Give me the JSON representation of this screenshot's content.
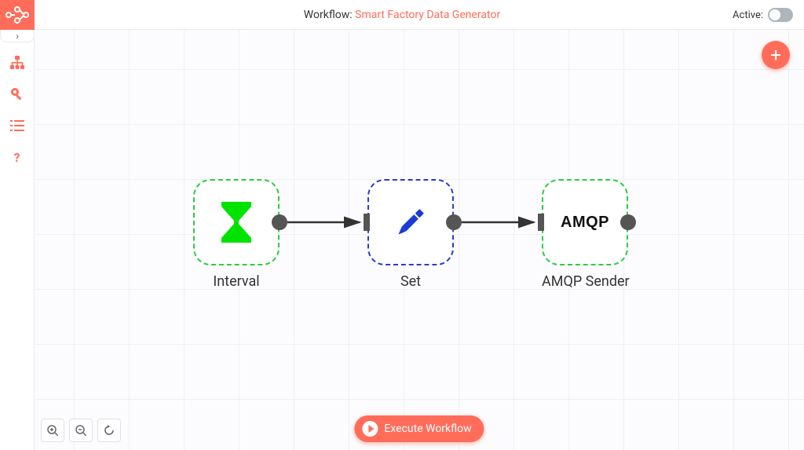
{
  "header": {
    "prefix": "Workflow: ",
    "name": "Smart Factory Data Generator",
    "active_label": "Active:",
    "active": false
  },
  "sidebar": {
    "items": [
      {
        "name": "workflows",
        "icon": "sitemap-icon"
      },
      {
        "name": "credentials",
        "icon": "key-icon"
      },
      {
        "name": "executions",
        "icon": "list-icon"
      },
      {
        "name": "help",
        "icon": "question-icon"
      }
    ]
  },
  "canvas": {
    "add_label": "+",
    "nodes": [
      {
        "id": "interval",
        "label": "Interval",
        "type": "trigger",
        "border": "green",
        "icon": "hourglass",
        "icon_text": ""
      },
      {
        "id": "set",
        "label": "Set",
        "type": "regular",
        "border": "blue",
        "icon": "pencil",
        "icon_text": ""
      },
      {
        "id": "amqp",
        "label": "AMQP Sender",
        "type": "regular",
        "border": "green",
        "icon": "text",
        "icon_text": "AMQP"
      }
    ],
    "connections": [
      {
        "from": "interval",
        "to": "set"
      },
      {
        "from": "set",
        "to": "amqp"
      }
    ]
  },
  "controls": {
    "zoom_in": "zoom-in",
    "zoom_out": "zoom-out",
    "reset": "reset",
    "execute_label": "Execute Workflow"
  }
}
